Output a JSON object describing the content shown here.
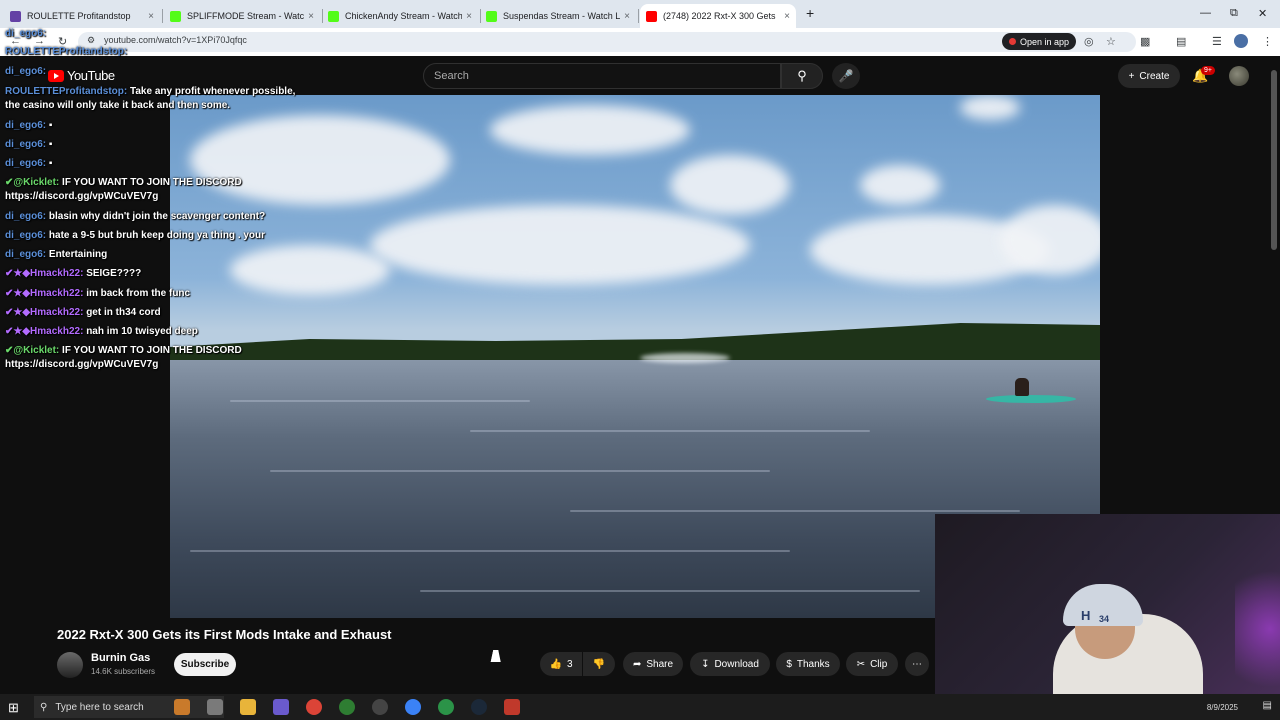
{
  "browser": {
    "tabs": [
      {
        "title": "ROULETTE Profitandstop",
        "favicon_color": "#6441a5",
        "close": "×"
      },
      {
        "title": "SPLIFFMODE Stream - Watch Li",
        "favicon_color": "#53fc18",
        "close": "×"
      },
      {
        "title": "ChickenAndy Stream - Watch Li",
        "favicon_color": "#53fc18",
        "close": "×"
      },
      {
        "title": "Suspendas Stream - Watch Live",
        "favicon_color": "#53fc18",
        "close": "×"
      },
      {
        "title": "(2748) 2022 Rxt-X 300 Gets",
        "favicon_color": "#ff0000",
        "close": "×"
      }
    ],
    "new_tab": "+",
    "url": "youtube.com/watch?v=1XPi70Jqfqc",
    "open_in_app": "Open in app",
    "window_controls": {
      "minimize": "—",
      "restore": "⧉",
      "close": "✕"
    }
  },
  "youtube": {
    "logo_text": "YouTube",
    "search_placeholder": "Search",
    "create_label": "Create",
    "notification_count": "9+",
    "video": {
      "title": "2022 Rxt-X 300 Gets its First Mods Intake and Exhaust",
      "channel": "Burnin Gas",
      "subscribers": "14.6K subscribers",
      "subscribe_label": "Subscribe",
      "likes": "3",
      "share_label": "Share",
      "download_label": "Download",
      "thanks_label": "Thanks",
      "clip_label": "Clip",
      "more_label": "⋯"
    }
  },
  "chat": [
    {
      "user": "di_ego6:",
      "user_class": "u",
      "text": ""
    },
    {
      "user": "ROULETTEProfitandstop:",
      "user_class": "u",
      "text": ""
    },
    {
      "user": "di_ego6:",
      "user_class": "u",
      "text": ""
    },
    {
      "user": "ROULETTEProfitandstop:",
      "user_class": "u",
      "text": "Take any profit whenever possible,"
    },
    {
      "user": "",
      "user_class": "u",
      "text": "the casino will only take it back and then some."
    },
    {
      "user": "di_ego6:",
      "user_class": "u",
      "text": "▪"
    },
    {
      "user": "di_ego6:",
      "user_class": "u",
      "text": "▪"
    },
    {
      "user": "di_ego6:",
      "user_class": "u",
      "text": "▪"
    },
    {
      "user": "✔@Kicklet:",
      "user_class": "g",
      "text": "IF YOU WANT TO JOIN THE DISCORD"
    },
    {
      "user": "",
      "user_class": "u",
      "text": "https://discord.gg/vpWCuVEV7g"
    },
    {
      "user": "di_ego6:",
      "user_class": "u",
      "text": "blasin why didn't join the scavenger content?"
    },
    {
      "user": "di_ego6:",
      "user_class": "u",
      "text": "hate a 9-5 but bruh keep doing ya thing . your"
    },
    {
      "user": "di_ego6:",
      "user_class": "u",
      "text": "Entertaining"
    },
    {
      "user": "✔★◆Hmackh22:",
      "user_class": "p",
      "text": "SEIGE????"
    },
    {
      "user": "✔★◆Hmackh22:",
      "user_class": "p",
      "text": "im back from the func"
    },
    {
      "user": "✔★◆Hmackh22:",
      "user_class": "p",
      "text": "get in th34 cord"
    },
    {
      "user": "✔★◆Hmackh22:",
      "user_class": "p",
      "text": "nah im 10 twisyed deep"
    },
    {
      "user": "✔@Kicklet:",
      "user_class": "g",
      "text": "IF YOU WANT TO JOIN THE DISCORD"
    },
    {
      "user": "",
      "user_class": "u",
      "text": "https://discord.gg/vpWCuVEV7g"
    }
  ],
  "webcam": {
    "hat_logo": "H",
    "hat_number": "34"
  },
  "taskbar": {
    "search_placeholder": "Type here to search",
    "date": "8/9/2025",
    "apps": [
      "#c97a2b",
      "#7a7a7a",
      "#e8b43a",
      "#6a5acd",
      "#db4437",
      "#2e7d32",
      "#444",
      "#3b82f6",
      "#2b9348",
      "#1b2838",
      "#c0392b"
    ]
  }
}
